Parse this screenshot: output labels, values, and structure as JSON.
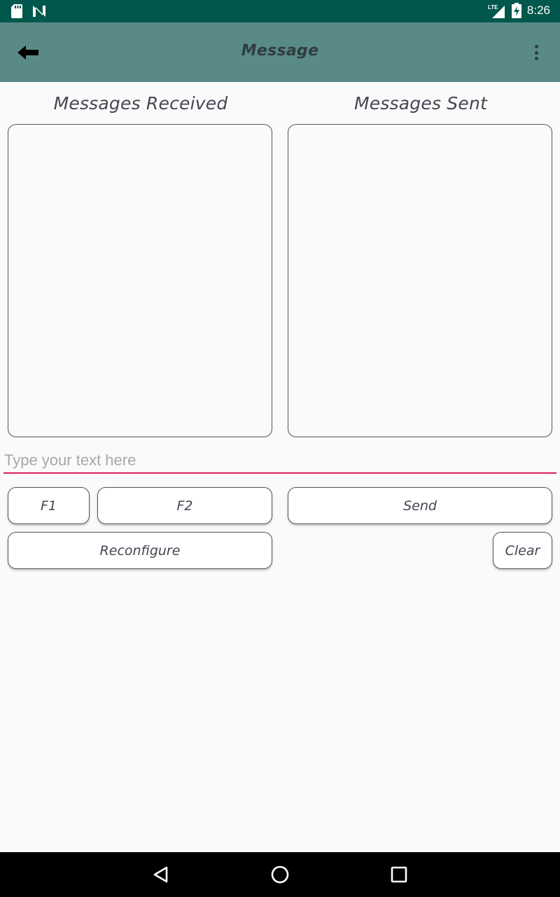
{
  "status_bar": {
    "time": "8:26",
    "network": "LTE",
    "icons": [
      "sd-card-icon",
      "n-notification-icon",
      "lte-signal-icon",
      "battery-charging-icon"
    ]
  },
  "app_bar": {
    "title": "Message",
    "back_icon": "back-arrow-icon",
    "menu_icon": "overflow-menu-icon"
  },
  "panels": {
    "received_title": "Messages Received",
    "sent_title": "Messages Sent"
  },
  "input": {
    "placeholder": "Type your text here",
    "value": ""
  },
  "buttons": {
    "f1": "F1",
    "f2": "F2",
    "send": "Send",
    "reconfigure": "Reconfigure",
    "clear": "Clear"
  },
  "nav_bar": {
    "icons": [
      "nav-back-icon",
      "nav-home-icon",
      "nav-recents-icon"
    ]
  },
  "colors": {
    "status_bar": "#00574b",
    "app_bar": "#5a8a87",
    "accent_underline": "#d81b60",
    "background": "#fafafa"
  }
}
